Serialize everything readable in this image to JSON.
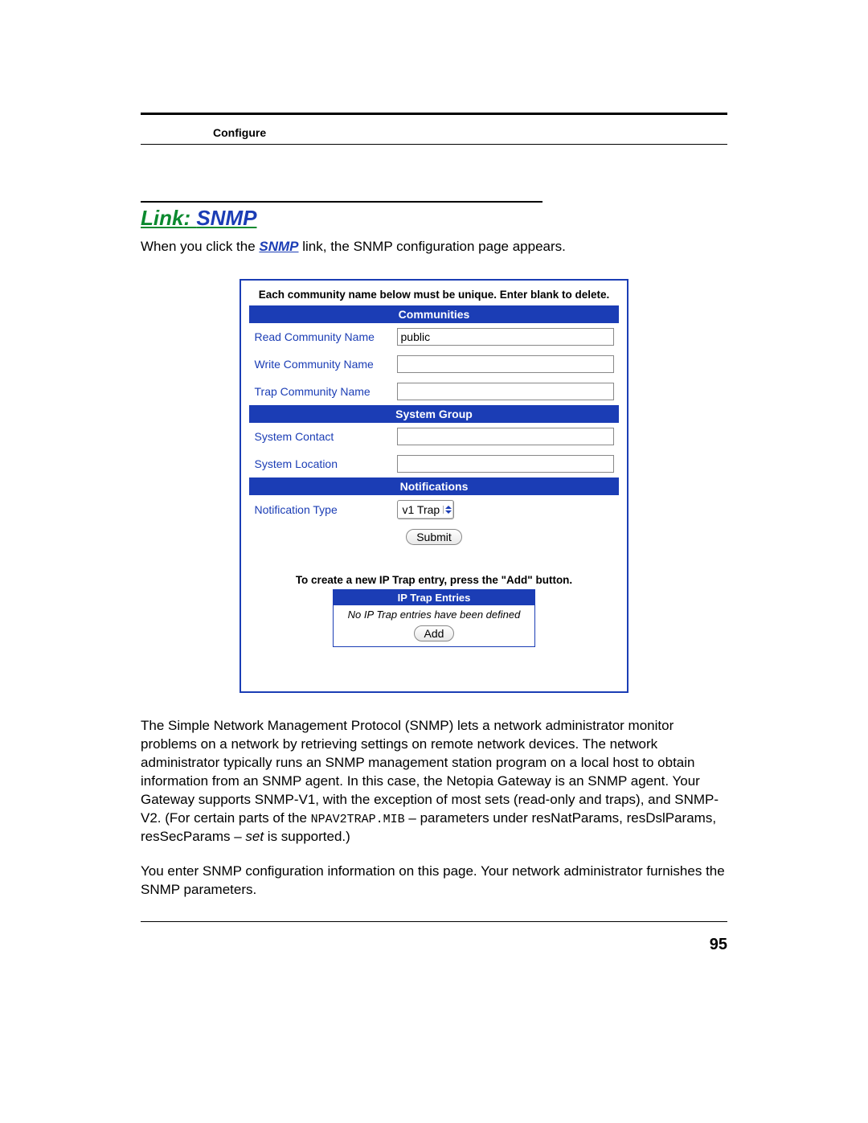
{
  "header": {
    "section_label": "Configure"
  },
  "title": {
    "prefix": "Link: ",
    "link": "SNMP"
  },
  "intro": {
    "before": "When you click the ",
    "link": "SNMP",
    "after": " link, the SNMP configuration page appears."
  },
  "screenshot": {
    "top_note": "Each community name below must be unique. Enter blank to delete.",
    "communities": {
      "header": "Communities",
      "rows": [
        {
          "label": "Read Community Name",
          "value": "public"
        },
        {
          "label": "Write Community Name",
          "value": ""
        },
        {
          "label": "Trap Community Name",
          "value": ""
        }
      ]
    },
    "system_group": {
      "header": "System Group",
      "rows": [
        {
          "label": "System Contact",
          "value": ""
        },
        {
          "label": "System Location",
          "value": ""
        }
      ]
    },
    "notifications": {
      "header": "Notifications",
      "type_label": "Notification Type",
      "type_value": "v1 Trap",
      "submit_label": "Submit"
    },
    "trap": {
      "note": "To create a new IP Trap entry, press the \"Add\" button.",
      "header": "IP Trap Entries",
      "empty_text": "No IP Trap entries have been defined",
      "add_label": "Add"
    }
  },
  "paragraphs": {
    "p1_a": "The Simple Network Management Protocol (SNMP) lets a network administrator monitor problems on a network by retrieving settings on remote network devices. The network administrator typically runs an SNMP management station program on a local host to obtain information from an SNMP agent. In this case, the Netopia Gateway is an SNMP agent. Your Gateway supports SNMP-V1, with the exception of most sets (read-only and traps), and SNMP-V2. (For certain parts of the ",
    "p1_mono": "NPAV2TRAP.MIB",
    "p1_b": " – parameters under resNat­Params, resDslParams, resSecParams – ",
    "p1_set": "set",
    "p1_c": " is supported.)",
    "p2": "You enter SNMP configuration information on this page. Your network administrator fur­nishes the SNMP parameters."
  },
  "page_number": "95"
}
